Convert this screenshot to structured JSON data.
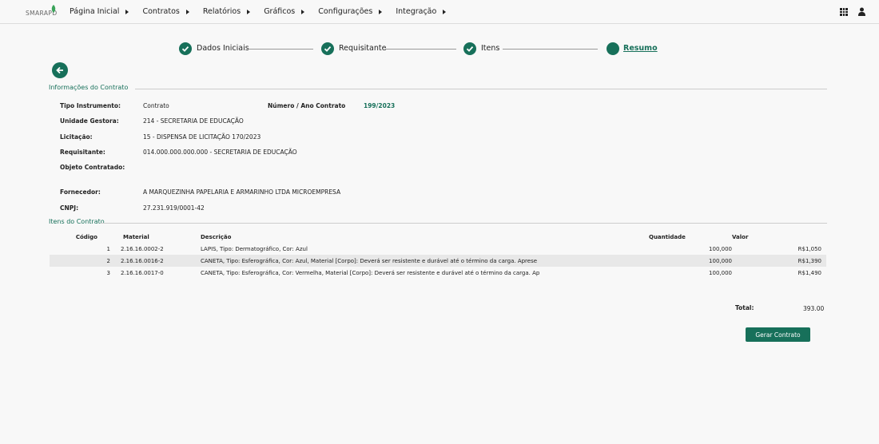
{
  "brand": {
    "logo_text": "SMARAPD",
    "accent_color": "#17705a"
  },
  "nav": {
    "items": [
      {
        "label": "Página Inicial"
      },
      {
        "label": "Contratos"
      },
      {
        "label": "Relatórios"
      },
      {
        "label": "Gráficos"
      },
      {
        "label": "Configurações"
      },
      {
        "label": "Integração"
      }
    ],
    "right_icons": [
      "apps-grid-icon",
      "user-icon"
    ]
  },
  "stepper": {
    "steps": [
      {
        "label": "Dados Iniciais",
        "state": "done",
        "icon": "check-icon"
      },
      {
        "label": "Requisitante",
        "state": "done",
        "icon": "check-icon"
      },
      {
        "label": "Itens",
        "state": "done",
        "icon": "check-icon"
      },
      {
        "label": "Resumo",
        "state": "current",
        "icon": ""
      }
    ]
  },
  "back_button": {
    "icon": "arrow-left-icon"
  },
  "contract_info": {
    "section_title": "Informações do Contrato",
    "tipo_instrumento": {
      "label": "Tipo Instrumento:",
      "value": "Contrato"
    },
    "numero_ano": {
      "label": "Número / Ano Contrato",
      "value": "199/2023"
    },
    "unidade_gestora": {
      "label": "Unidade Gestora:",
      "value": "214 - SECRETARIA DE EDUCAÇÃO"
    },
    "licitacao": {
      "label": "Licitação:",
      "value": "15 - DISPENSA DE LICITAÇÃO 170/2023"
    },
    "requisitante": {
      "label": "Requisitante:",
      "value": "014.000.000.000.000 - SECRETARIA DE EDUCAÇÃO"
    },
    "objeto": {
      "label": "Objeto Contratado:",
      "value": ""
    },
    "fornecedor": {
      "label": "Fornecedor:",
      "value": "A MARQUEZINHA PAPELARIA E ARMARINHO LTDA MICROEMPRESA"
    },
    "cnpj": {
      "label": "CNPJ:",
      "value": "27.231.919/0001-42"
    }
  },
  "items": {
    "section_title": "Itens do Contrato",
    "columns": {
      "codigo": "Código",
      "material": "Material",
      "descricao": "Descrição",
      "quantidade": "Quantidade",
      "valor": "Valor"
    },
    "rows": [
      {
        "codigo": "1",
        "material": "2.16.16.0002-2",
        "descricao": "LAPIS, Tipo: Dermatográfico, Cor: Azul",
        "quantidade": "100,000",
        "valor": "R$1,050"
      },
      {
        "codigo": "2",
        "material": "2.16.16.0016-2",
        "descricao": "CANETA, Tipo: Esferográfica, Cor: Azul, Material [Corpo]: Deverá ser resistente e durável até o término da carga. Aprese",
        "quantidade": "100,000",
        "valor": "R$1,390"
      },
      {
        "codigo": "3",
        "material": "2.16.16.0017-0",
        "descricao": "CANETA, Tipo: Esferográfica, Cor: Vermelha, Material [Corpo]: Deverá ser resistente e durável até o término da carga. Ap",
        "quantidade": "100,000",
        "valor": "R$1,490"
      }
    ]
  },
  "total": {
    "label": "Total:",
    "value": "393.00"
  },
  "actions": {
    "generate_label": "Gerar Contrato"
  }
}
